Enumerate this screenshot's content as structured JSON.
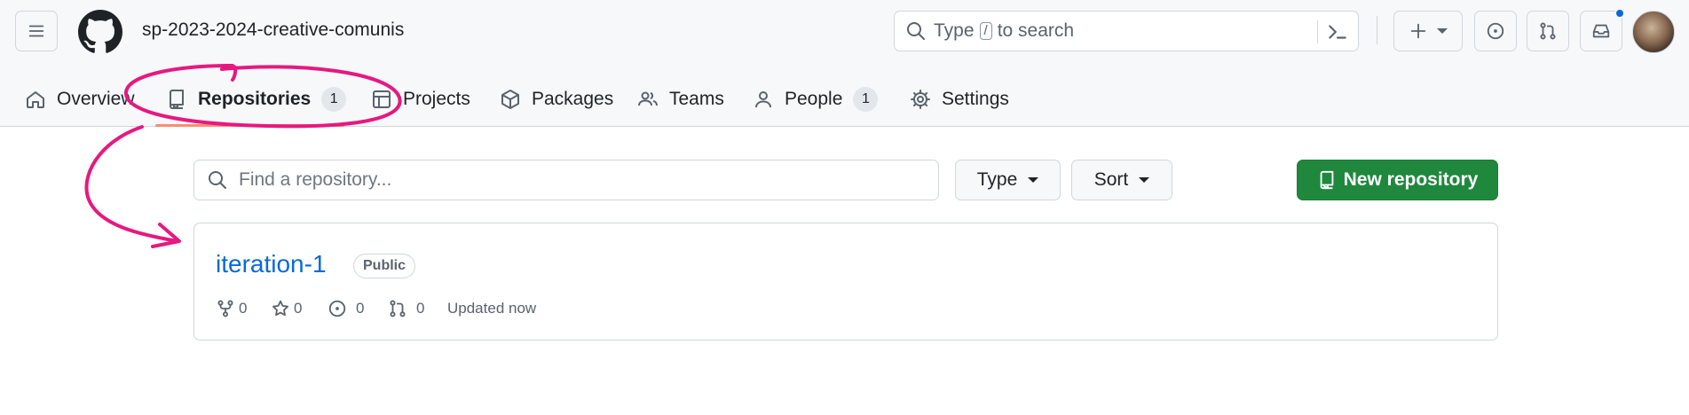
{
  "org": {
    "name": "sp-2023-2024-creative-comunis"
  },
  "search": {
    "prefix": "Type",
    "key": "/",
    "suffix": "to search"
  },
  "tabs": [
    {
      "label": "Overview"
    },
    {
      "label": "Repositories",
      "count": "1"
    },
    {
      "label": "Projects"
    },
    {
      "label": "Packages"
    },
    {
      "label": "Teams"
    },
    {
      "label": "People",
      "count": "1"
    },
    {
      "label": "Settings"
    }
  ],
  "filter": {
    "placeholder": "Find a repository...",
    "type_label": "Type",
    "sort_label": "Sort",
    "new_label": "New repository"
  },
  "repos": [
    {
      "name": "iteration-1",
      "visibility": "Public",
      "forks": "0",
      "stars": "0",
      "issues": "0",
      "pulls": "0",
      "updated": "Updated now"
    }
  ],
  "colors": {
    "accent": "#0969da",
    "primary_button": "#1f883d",
    "active_tab_underline": "#fd8c73",
    "annotation": "#e6197f"
  },
  "icons": [
    "menu-icon",
    "github-logo-icon",
    "search-icon",
    "command-palette-icon",
    "plus-icon",
    "issues-icon",
    "pull-request-icon",
    "inbox-icon",
    "home-icon",
    "repo-icon",
    "project-icon",
    "package-icon",
    "people-icon",
    "person-icon",
    "gear-icon",
    "fork-icon",
    "star-icon"
  ]
}
